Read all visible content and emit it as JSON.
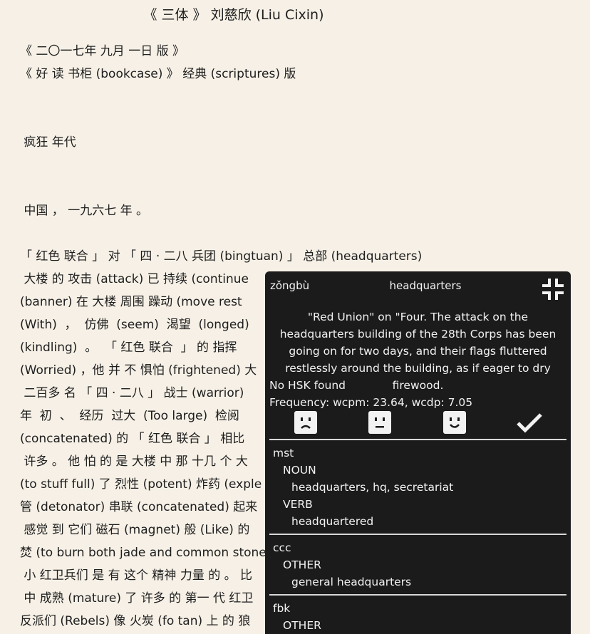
{
  "book": {
    "title": "《 三体 》 刘慈欣 (Liu Cixin)",
    "lines": [
      "《 二〇一七年 九月 一日 版 》",
      "《 好 读 书柜 (bookcase) 》 经典 (scriptures) 版",
      " 疯狂 年代",
      " 中国 ， 一九六七 年 。",
      "「 红色 联合 」 对 「 四 · 二八 兵团 (bingtuan) 」 总部 (headquarters)",
      " 大楼 的 攻击 (attack) 已 持续 (continue",
      "(banner) 在 大楼 周围 躁动 (move rest",
      "(With)  ，  仿佛  (seem)  渴望  (longed)",
      "(kindling)  。  「 红色 联合  」 的 指挥",
      "(Worried) ，他 并 不 惧怕 (frightened) 大",
      " 二百多 名 「 四 · 二八 」 战士 (warrior)",
      "年  初  、  经历  过大  (Too large)  检阅",
      "(concatenated) 的 「 红色 联合 」 相比",
      " 许多 。 他 怕 的 是 大楼 中 那 十几 个 大",
      "(to stuff full) 了 烈性 (potent) 炸药 (exple",
      "管 (detonator) 串联 (concatenated) 起来",
      " 感觉 到 它们 磁石 (magnet) 般 (Like) 的",
      "焚 (to burn both jade and common stone",
      " 小 红卫兵们 是 有 这个 精神 力量 的 。 比",
      " 中 成熟 (mature) 了 许多 的 第一 代 红卫",
      "反派们 (Rebels) 像 火炭 (fo tan) 上 的 狼"
    ]
  },
  "popup": {
    "pinyin": "zǒngbù",
    "gloss": "headquarters",
    "sentence": "\"Red Union\" on \"Four. The attack on the headquarters building of the 28th Corps has been going on for two days, and their flags fluttered restlessly around the building, as if eager to dry firewood.",
    "hsk": "No HSK found",
    "frequency": "Frequency: wcpm: 23.64, wcdp: 7.05",
    "dictionaries": [
      {
        "name": "mst",
        "groups": [
          {
            "pos": "NOUN",
            "defs": "headquarters, hq, secretariat"
          },
          {
            "pos": "VERB",
            "defs": "headquartered"
          }
        ]
      },
      {
        "name": "ccc",
        "groups": [
          {
            "pos": "OTHER",
            "defs": "general headquarters"
          }
        ]
      },
      {
        "name": "fbk",
        "groups": [
          {
            "pos": "OTHER",
            "defs": ""
          }
        ]
      }
    ]
  },
  "icons": {
    "collapse": "collapse-icon",
    "sad": "sad-face-icon",
    "neutral": "neutral-face-icon",
    "happy": "happy-face-icon",
    "known": "checkmark-icon"
  },
  "colors": {
    "page_bg": "#f6f0e6",
    "popup_bg": "#1b1b1b",
    "popup_text": "#f2f2f2"
  }
}
